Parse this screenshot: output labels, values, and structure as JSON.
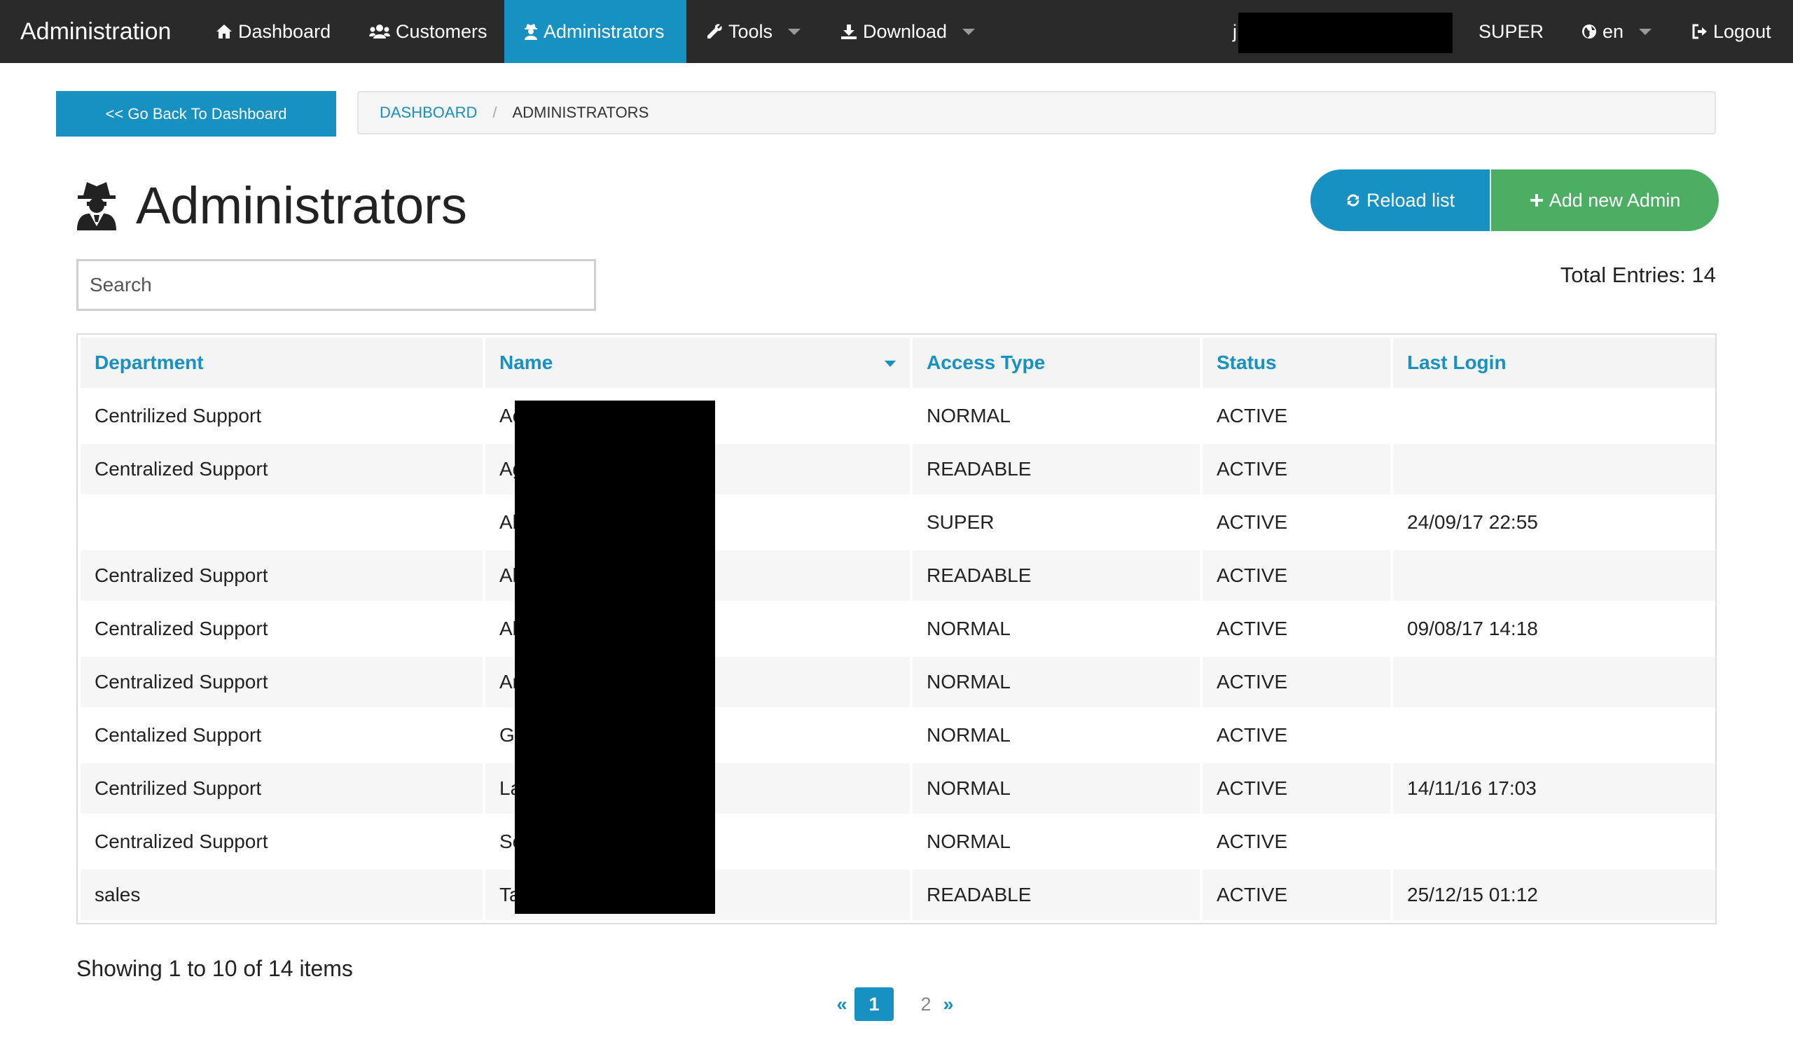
{
  "navbar": {
    "brand": "Administration",
    "items": [
      {
        "label": "Dashboard",
        "icon": "home-icon"
      },
      {
        "label": "Customers",
        "icon": "users-icon"
      },
      {
        "label": "Administrators",
        "icon": "user-secret-icon",
        "active": true
      },
      {
        "label": "Tools",
        "icon": "wrench-icon",
        "dropdown": true
      },
      {
        "label": "Download",
        "icon": "download-icon",
        "dropdown": true
      }
    ],
    "user_prefix": "j",
    "role": "SUPER",
    "language": "en",
    "logout": "Logout"
  },
  "back_button": "<< Go Back To Dashboard",
  "breadcrumb": {
    "link": "DASHBOARD",
    "separator": "/",
    "current": "ADMINISTRATORS"
  },
  "header": {
    "title": "Administrators",
    "reload_label": "Reload list",
    "add_label": "Add new Admin"
  },
  "search": {
    "placeholder": "Search"
  },
  "total_entries": "Total Entries: 14",
  "table": {
    "columns": [
      "Department",
      "Name",
      "Access Type",
      "Status",
      "Last Login"
    ],
    "rows": [
      {
        "department": "Centrilized Support",
        "name": "Ac",
        "access": "NORMAL",
        "status": "ACTIVE",
        "last_login": ""
      },
      {
        "department": "Centralized Support",
        "name": "Ag",
        "access": "READABLE",
        "status": "ACTIVE",
        "last_login": ""
      },
      {
        "department": "",
        "name": "Al",
        "access": "SUPER",
        "status": "ACTIVE",
        "last_login": "24/09/17 22:55"
      },
      {
        "department": "Centralized Support",
        "name": "Al",
        "access": "READABLE",
        "status": "ACTIVE",
        "last_login": ""
      },
      {
        "department": "Centralized Support",
        "name": "Al",
        "access": "NORMAL",
        "status": "ACTIVE",
        "last_login": "09/08/17 14:18"
      },
      {
        "department": "Centralized Support",
        "name": "Ar",
        "access": "NORMAL",
        "status": "ACTIVE",
        "last_login": ""
      },
      {
        "department": "Centalized Support",
        "name": "G",
        "access": "NORMAL",
        "status": "ACTIVE",
        "last_login": ""
      },
      {
        "department": "Centrilized Support",
        "name": "La",
        "access": "NORMAL",
        "status": "ACTIVE",
        "last_login": "14/11/16 17:03"
      },
      {
        "department": "Centralized Support",
        "name": "Se",
        "access": "NORMAL",
        "status": "ACTIVE",
        "last_login": ""
      },
      {
        "department": "sales",
        "name": "Ta",
        "access": "READABLE",
        "status": "ACTIVE",
        "last_login": "25/12/15 01:12"
      }
    ]
  },
  "showing": "Showing 1 to 10 of 14 items",
  "pagination": {
    "prev": "«",
    "pages": [
      "1",
      "2"
    ],
    "current": "1",
    "next": "»"
  },
  "colors": {
    "navbar_bg": "#2a2a2a",
    "accent": "#1790c2",
    "success": "#4cae62"
  }
}
